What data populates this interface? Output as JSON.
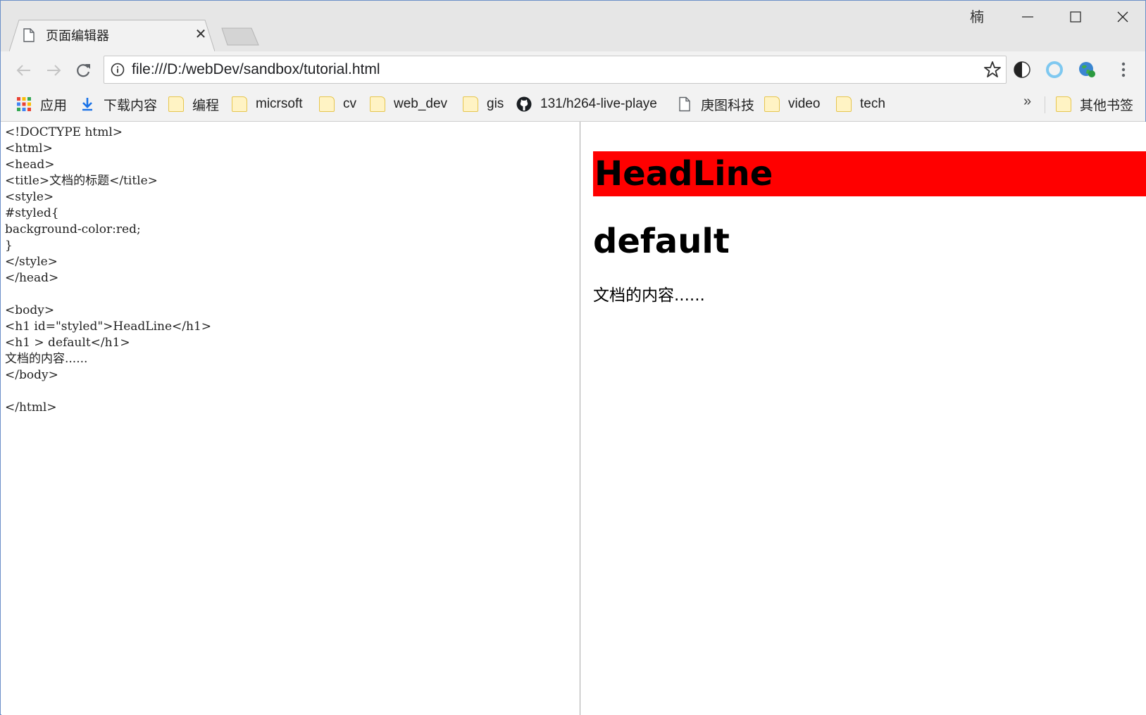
{
  "window": {
    "user_badge": "楠"
  },
  "tab": {
    "title": "页面编辑器",
    "close_glyph": "✕"
  },
  "toolbar": {
    "url": "file:///D:/webDev/sandbox/tutorial.html"
  },
  "bookmarks": {
    "items": [
      {
        "label": "应用",
        "icon": "apps-grid-icon"
      },
      {
        "label": "下载内容",
        "icon": "download-icon"
      },
      {
        "label": "编程",
        "icon": "folder-icon"
      },
      {
        "label": "micrsoft",
        "icon": "folder-icon"
      },
      {
        "label": "cv",
        "icon": "folder-icon"
      },
      {
        "label": "web_dev",
        "icon": "folder-icon"
      },
      {
        "label": "gis",
        "icon": "folder-icon"
      },
      {
        "label": "131/h264-live-playe",
        "icon": "github-icon"
      },
      {
        "label": "庚图科技",
        "icon": "page-icon"
      },
      {
        "label": "video",
        "icon": "folder-icon"
      },
      {
        "label": "tech",
        "icon": "folder-icon"
      }
    ],
    "overflow": "»",
    "other": "其他书签"
  },
  "editor": {
    "lines": [
      "<!DOCTYPE html>",
      "<html>",
      "<head>",
      "<title>文档的标题</title>",
      "<style>",
      "#styled{",
      "background-color:red;",
      "}",
      "</style>",
      "</head>",
      "",
      "<body>",
      "<h1 id=\"styled\">HeadLine</h1>",
      "<h1 > default</h1>",
      "文档的内容......",
      "</body>",
      "",
      "</html>"
    ]
  },
  "preview": {
    "headline": "HeadLine",
    "headline_bg": "#ff0000",
    "default_heading": "default",
    "paragraph": "文档的内容......"
  }
}
